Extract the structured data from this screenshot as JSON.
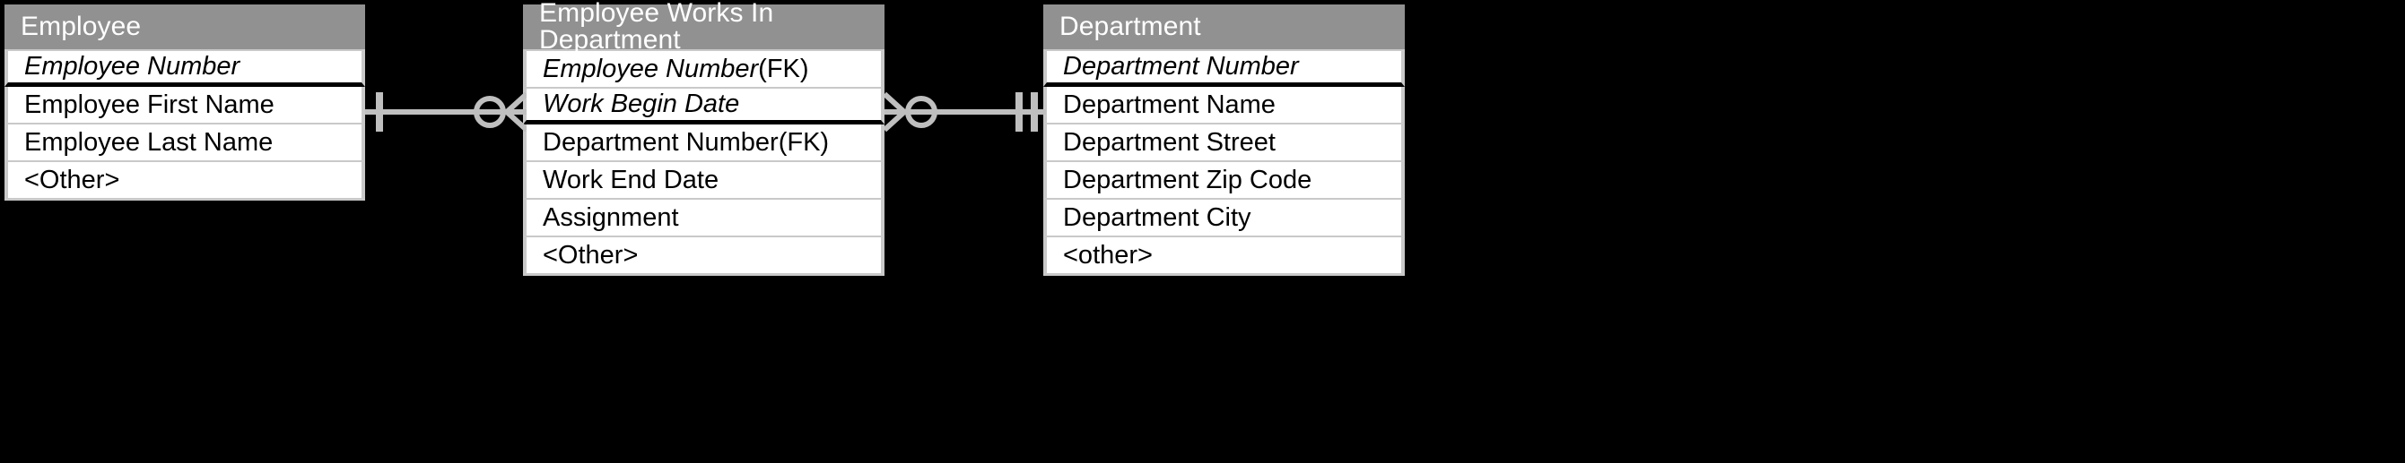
{
  "diagram": {
    "notation": "crows-foot",
    "background_color": "#000000",
    "header_color": "#919191",
    "header_text_color": "#ffffff",
    "row_color": "#ffffff",
    "row_border_color": "#c9c9c9",
    "connector_color": "#bfbfbf",
    "pk_rule_color": "#000000"
  },
  "entities": [
    {
      "id": "employee",
      "title": "Employee",
      "attributes": [
        {
          "name": "Employee Number",
          "suffix": "",
          "key": "PK",
          "italic": true,
          "pk_end": true
        },
        {
          "name": "Employee First Name",
          "suffix": "",
          "key": "",
          "italic": false,
          "pk_end": false
        },
        {
          "name": "Employee Last Name",
          "suffix": "",
          "key": "",
          "italic": false,
          "pk_end": false
        },
        {
          "name": "<Other>",
          "suffix": "",
          "key": "",
          "italic": false,
          "pk_end": false
        }
      ]
    },
    {
      "id": "employee_works_in_department",
      "title": "Employee Works In Department",
      "attributes": [
        {
          "name": "Employee Number",
          "suffix": " (FK)",
          "key": "PK,FK",
          "italic": true,
          "pk_end": false
        },
        {
          "name": "Work Begin Date",
          "suffix": "",
          "key": "PK",
          "italic": true,
          "pk_end": true
        },
        {
          "name": "Department Number",
          "suffix": " (FK)",
          "key": "FK",
          "italic": false,
          "pk_end": false
        },
        {
          "name": "Work End Date",
          "suffix": "",
          "key": "",
          "italic": false,
          "pk_end": false
        },
        {
          "name": "Assignment",
          "suffix": "",
          "key": "",
          "italic": false,
          "pk_end": false
        },
        {
          "name": "<Other>",
          "suffix": "",
          "key": "",
          "italic": false,
          "pk_end": false
        }
      ]
    },
    {
      "id": "department",
      "title": "Department",
      "attributes": [
        {
          "name": "Department Number",
          "suffix": "",
          "key": "PK",
          "italic": true,
          "pk_end": true
        },
        {
          "name": "Department Name",
          "suffix": "",
          "key": "",
          "italic": false,
          "pk_end": false
        },
        {
          "name": "Department Street",
          "suffix": "",
          "key": "",
          "italic": false,
          "pk_end": false
        },
        {
          "name": "Department Zip Code",
          "suffix": "",
          "key": "",
          "italic": false,
          "pk_end": false
        },
        {
          "name": "Department City",
          "suffix": "",
          "key": "",
          "italic": false,
          "pk_end": false
        },
        {
          "name": "<other>",
          "suffix": "",
          "key": "",
          "italic": false,
          "pk_end": false
        }
      ]
    }
  ],
  "relationships": [
    {
      "id": "employee-to-works-in",
      "from": "employee",
      "to": "employee_works_in_department",
      "from_cardinality": "exactly-one",
      "to_cardinality": "zero-or-many"
    },
    {
      "id": "works-in-to-department",
      "from": "employee_works_in_department",
      "to": "department",
      "from_cardinality": "zero-or-many",
      "to_cardinality": "exactly-one"
    }
  ]
}
